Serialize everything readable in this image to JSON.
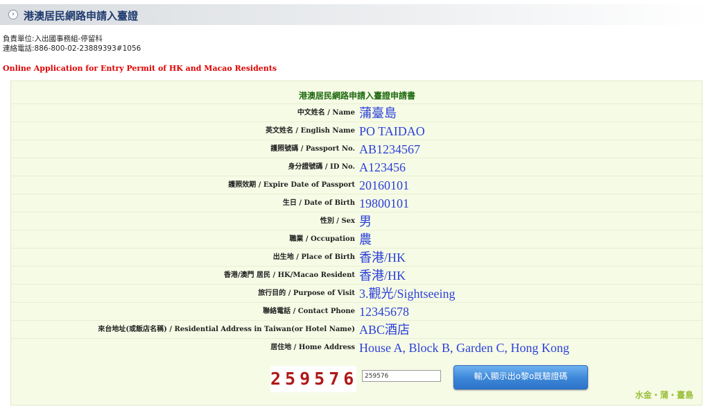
{
  "header": {
    "title": "港澳居民網路申請入臺證"
  },
  "contact": {
    "unit": "負責單位:入出國事務組-停留科",
    "phone": "連絡電話:886-800-02-23889393#1056"
  },
  "online_title": "Online Application for Entry Permit of HK and Macao Residents",
  "form": {
    "title": "港澳居民網路申請入臺證申請書",
    "rows": [
      {
        "label": "中文姓名 / Name",
        "value": "蒲臺島"
      },
      {
        "label": "英文姓名 / English Name",
        "value": "PO TAIDAO"
      },
      {
        "label": "護照號碼 / Passport No.",
        "value": "AB1234567"
      },
      {
        "label": "身分證號碼 / ID No.",
        "value": "A123456"
      },
      {
        "label": "護照效期 / Expire Date of Passport",
        "value": "20160101"
      },
      {
        "label": "生日 / Date of Birth",
        "value": "19800101"
      },
      {
        "label": "性別 / Sex",
        "value": "男"
      },
      {
        "label": "職業 / Occupation",
        "value": "農"
      },
      {
        "label": "出生地 / Place of Birth",
        "value": "香港/HK"
      },
      {
        "label": "香港/澳門 居民 / HK/Macao Resident",
        "value": "香港/HK"
      },
      {
        "label": "旅行目的 / Purpose of Visit",
        "value": "3.觀光/Sightseeing"
      },
      {
        "label": "聯絡電話 / Contact Phone",
        "value": "12345678"
      },
      {
        "label": "來台地址(或飯店名稱) / Residential Address in Taiwan(or Hotel Name)",
        "value": "ABC酒店"
      },
      {
        "label": "居住地 / Home Address",
        "value": "House A, Block B, Garden C, Hong Kong"
      }
    ],
    "captcha_code": "259576",
    "captcha_input": "259576",
    "submit_label": "輸入顯示出o黎o既驗證碼",
    "watermark": "水金・蒲・臺島"
  }
}
